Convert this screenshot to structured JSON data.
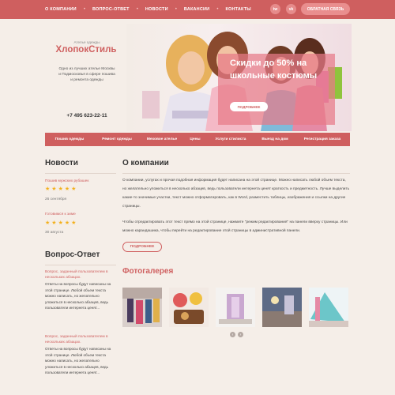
{
  "top_nav": {
    "items": [
      "О компании",
      "Вопрос-ответ",
      "Новости",
      "Вакансии",
      "Контакты"
    ],
    "social": [
      "tw",
      "vk"
    ],
    "callback_label": "Обратная связь"
  },
  "logo": {
    "tagline": "Ателье одежды",
    "name": "ХлопокСтиль",
    "description": "Одно из лучших ателье Москвы и Подмосковья в сфере пошива и ремонта одежды"
  },
  "phone": "+7 495 623-22-11",
  "hero": {
    "title": "Скидки до 50% на школьные костюмы",
    "button_label": "Подробнее"
  },
  "categories": [
    "Пошив одежды",
    "Ремонт одежды",
    "Меховое ателье",
    "Цены",
    "Услуги стилиста",
    "Выезд на дом",
    "Регистрация заказа"
  ],
  "sidebar": {
    "news_heading": "Новости",
    "news": [
      {
        "title": "Пошив мужских рубашек",
        "rating": 5,
        "date": "26 сентября"
      },
      {
        "title": "Готовимся к зиме",
        "rating": 5,
        "date": "30 августа"
      }
    ],
    "qa_heading": "Вопрос-Ответ",
    "qa": [
      {
        "question": "Вопрос, заданный пользователем в нескольких абзацах.",
        "answer": "Ответы на вопросы будут написаны на этой странице. Любой объем текста можно написать, но желательно уложиться в несколько абзацев, ведь пользователи интернета ценят..."
      },
      {
        "question": "Вопрос, заданный пользователем в нескольких абзацах.",
        "answer": "Ответы на вопросы будут написаны на этой странице. Любой объем текста можно написать, но желательно уложиться в несколько абзацев, ведь пользователи интернета ценят..."
      }
    ]
  },
  "main": {
    "heading": "О компании",
    "paragraphs": [
      "О компании, услугах и прочая подобная информация будет написана на этой странице. Можно написать любой объем текста, но желательно уложиться в несколько абзацев, ведь пользователи интернета ценят краткость и предметность. Лучше выделить какие-то значимые участки, текст можно отформатировать, как в Word, разместить таблицы, изображения и ссылки на другие страницы.",
      "Чтобы отредактировать этот текст прямо на этой странице, нажмите \"режим редактирования\" на панели вверху страницы. Или можно карандашика, чтобы перейти на редактирование этой страницы в административной панели."
    ],
    "more_label": "Подробнее",
    "gallery_heading": "Фотогалерея",
    "gallery_prev": "‹",
    "gallery_next": "›"
  },
  "colors": {
    "accent": "#cf5f5f",
    "background": "#f5eee8",
    "star": "#f3b01c"
  }
}
